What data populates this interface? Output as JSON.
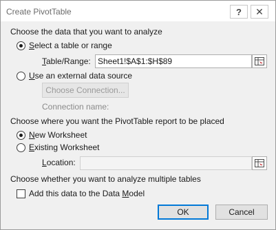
{
  "dialog": {
    "title": "Create PivotTable",
    "help_glyph": "?",
    "close_glyph": "✕"
  },
  "source_section": {
    "title": "Choose the data that you want to analyze",
    "option_table": {
      "label_key": "S",
      "label_rest": "elect a table or range",
      "selected": true
    },
    "range_label_key": "T",
    "range_label_rest": "able/Range:",
    "range_value": "Sheet1!$A$1:$H$89",
    "option_external": {
      "label_key": "U",
      "label_rest": "se an external data source",
      "selected": false
    },
    "choose_connection_label": "Choose Connection...",
    "connection_name_label": "Connection name:"
  },
  "placement_section": {
    "title": "Choose where you want the PivotTable report to be placed",
    "option_new": {
      "label_key": "N",
      "label_rest": "ew Worksheet",
      "selected": true
    },
    "option_existing": {
      "label_key": "E",
      "label_rest": "xisting Worksheet",
      "selected": false
    },
    "location_label_key": "L",
    "location_label_rest": "ocation:",
    "location_value": ""
  },
  "multi_section": {
    "title": "Choose whether you want to analyze multiple tables",
    "checkbox_label_pre": "Add this data to the Data ",
    "checkbox_label_key": "M",
    "checkbox_label_post": "odel",
    "checked": false
  },
  "footer": {
    "ok_label": "OK",
    "cancel_label": "Cancel"
  },
  "colors": {
    "accent": "#0078d7",
    "ref_icon_red": "#c0272d"
  }
}
